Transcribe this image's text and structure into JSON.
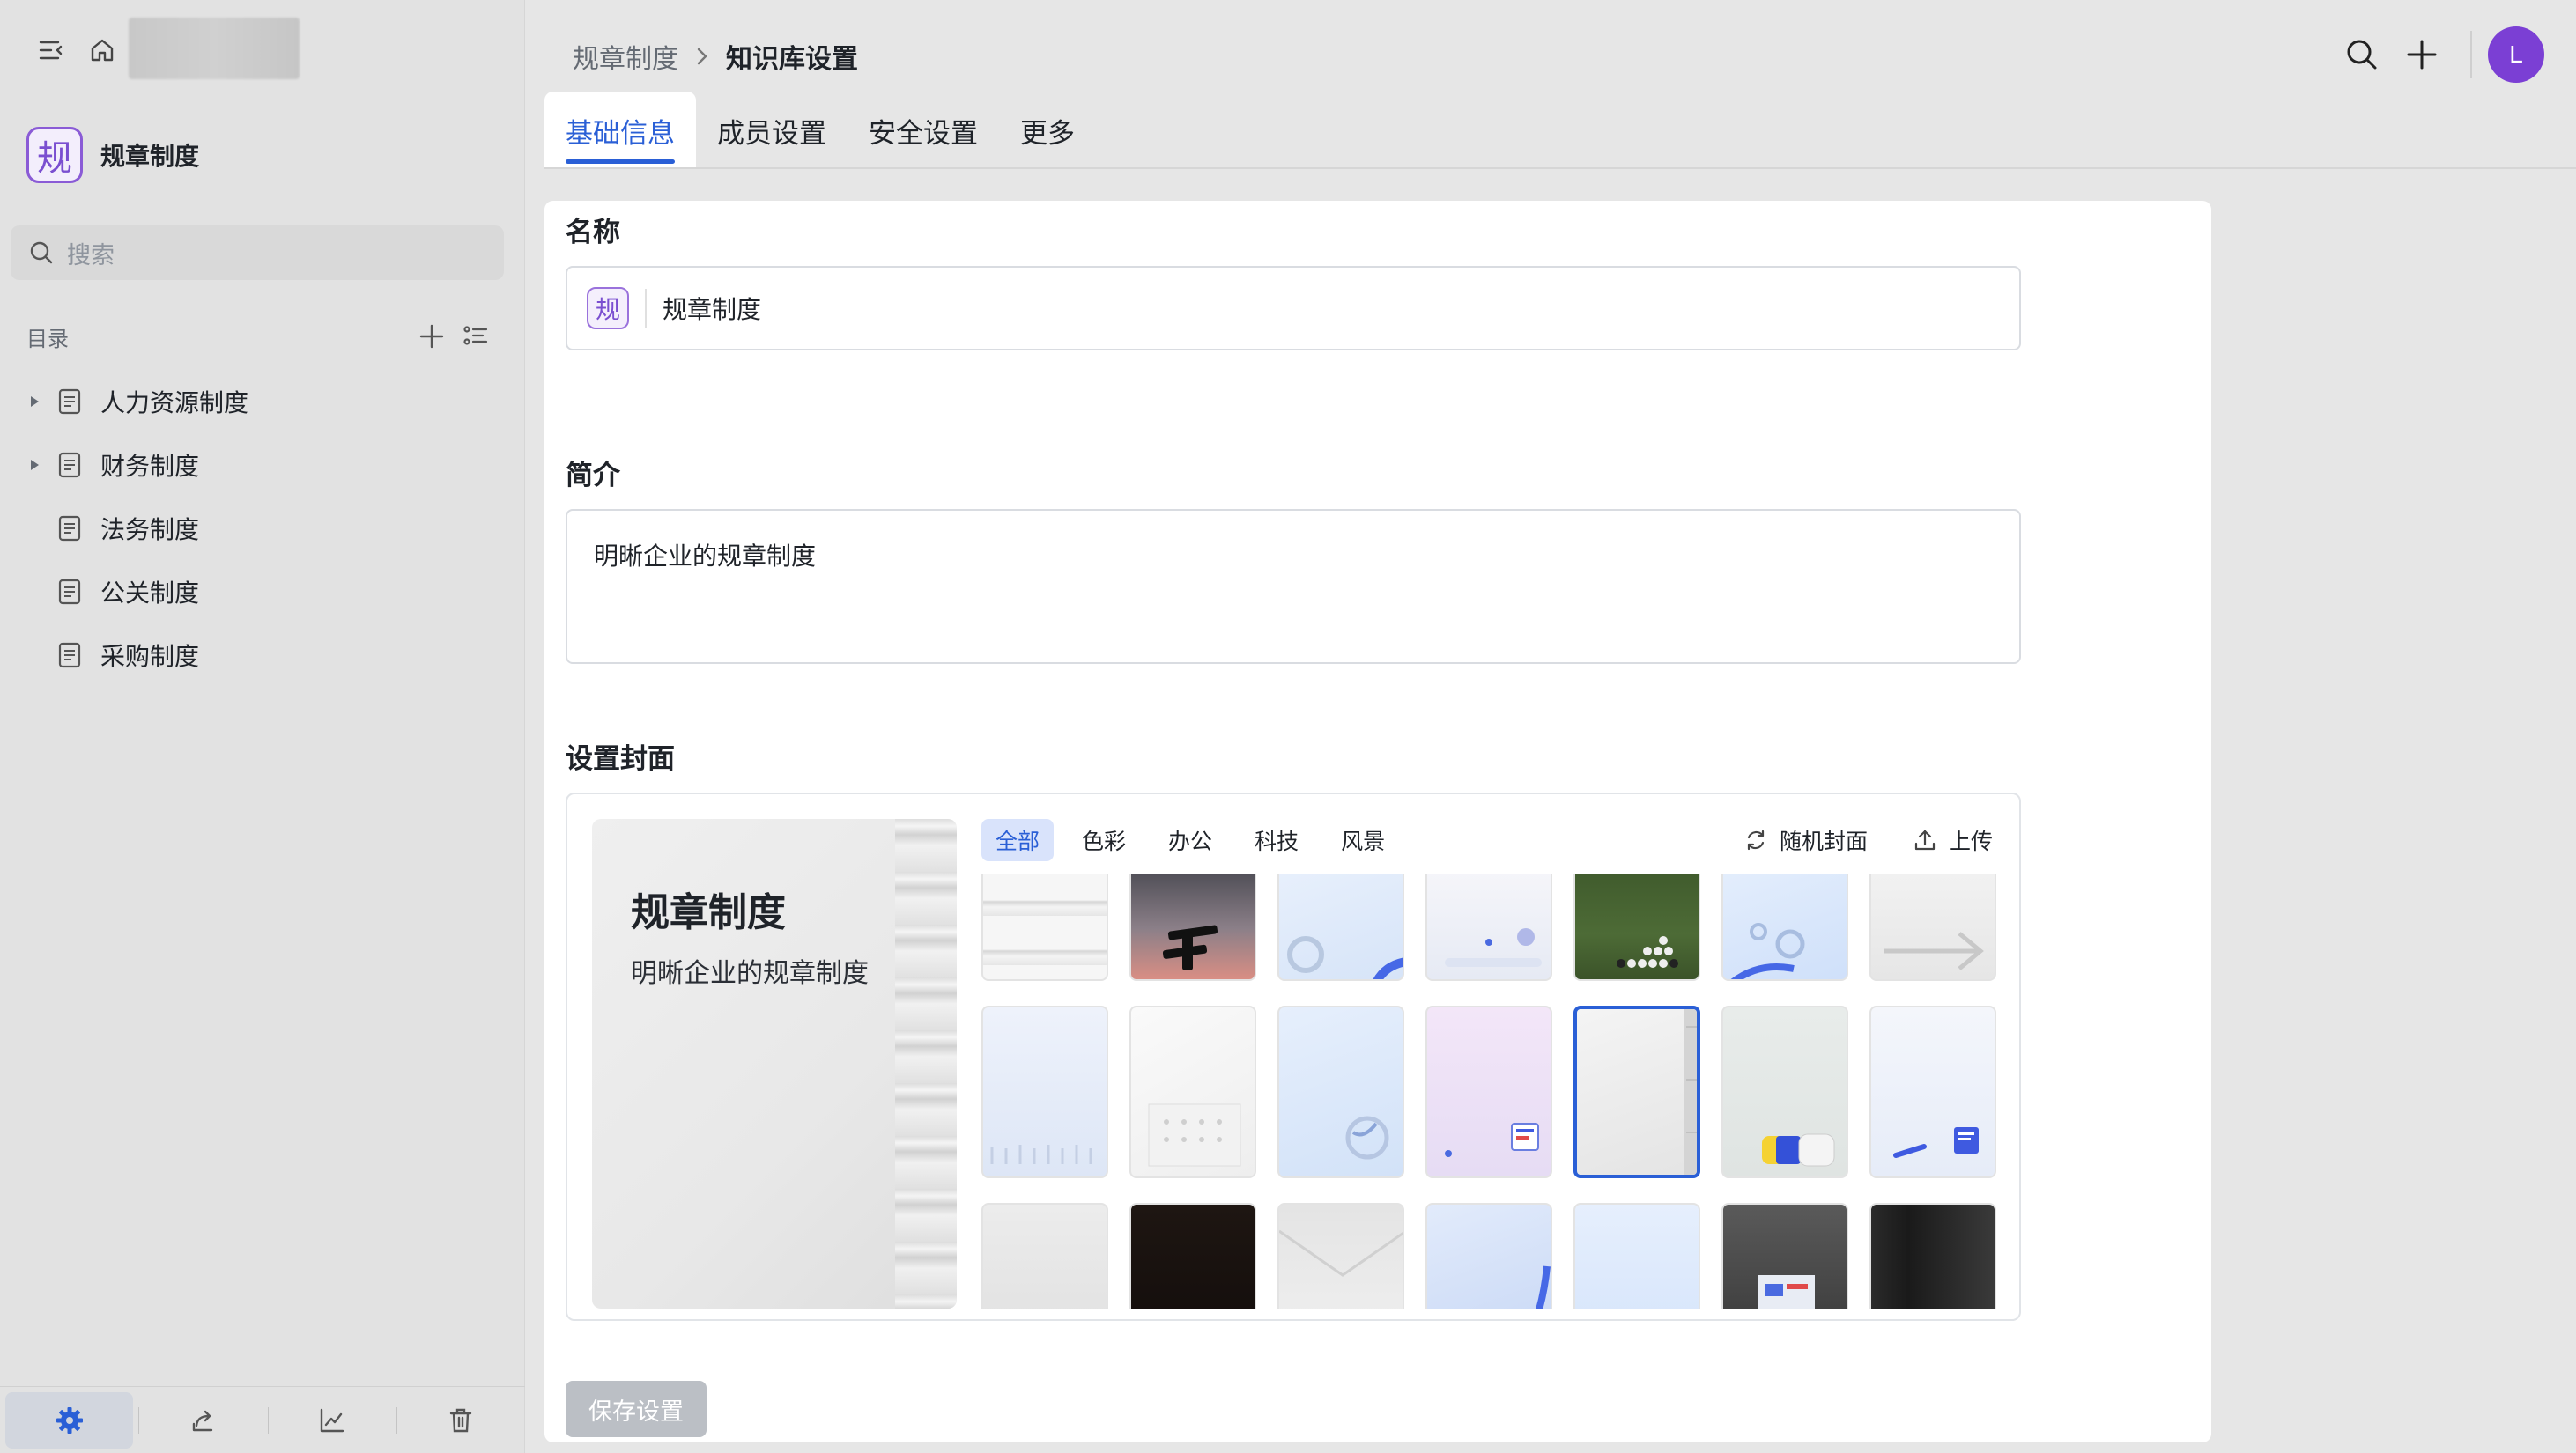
{
  "sidebar": {
    "kb_name": "规章制度",
    "kb_badge": "规",
    "search_placeholder": "搜索",
    "toc_label": "目录",
    "tree": [
      {
        "label": "人力资源制度",
        "has_children": true
      },
      {
        "label": "财务制度",
        "has_children": true
      },
      {
        "label": "法务制度",
        "has_children": false
      },
      {
        "label": "公关制度",
        "has_children": false
      },
      {
        "label": "采购制度",
        "has_children": false
      }
    ],
    "bottom_icons": [
      "settings-icon",
      "share-icon",
      "analytics-icon",
      "trash-icon"
    ]
  },
  "header": {
    "breadcrumb": [
      "规章制度",
      "知识库设置"
    ],
    "avatar_letter": "L",
    "accent_color": "#2a5fd6",
    "avatar_color": "#7b3fd4"
  },
  "tabs": [
    {
      "label": "基础信息",
      "active": true
    },
    {
      "label": "成员设置",
      "active": false
    },
    {
      "label": "安全设置",
      "active": false
    },
    {
      "label": "更多",
      "active": false
    }
  ],
  "form": {
    "name_title": "名称",
    "name_badge": "规",
    "name_value": "规章制度",
    "desc_title": "简介",
    "desc_value": "明晰企业的规章制度",
    "cover_title": "设置封面",
    "preview_title": "规章制度",
    "preview_subtitle": "明晰企业的规章制度",
    "filters": [
      {
        "label": "全部",
        "active": true
      },
      {
        "label": "色彩",
        "active": false
      },
      {
        "label": "办公",
        "active": false
      },
      {
        "label": "科技",
        "active": false
      },
      {
        "label": "风景",
        "active": false
      }
    ],
    "random_cover": "随机封面",
    "upload": "上传",
    "save_label": "保存设置"
  }
}
